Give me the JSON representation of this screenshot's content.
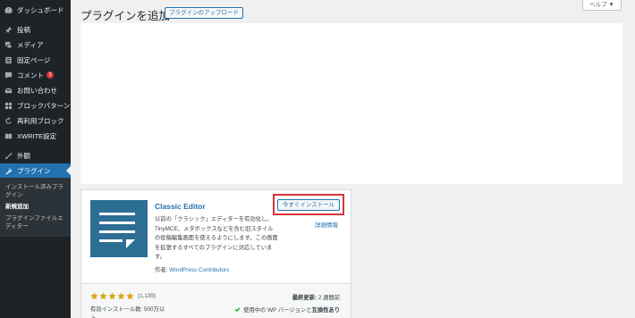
{
  "sidebar": {
    "items": [
      {
        "label": "ダッシュボード",
        "icon": "dashboard-icon"
      },
      {
        "label": "投稿",
        "icon": "pin-icon"
      },
      {
        "label": "メディア",
        "icon": "media-icon"
      },
      {
        "label": "固定ページ",
        "icon": "page-icon"
      },
      {
        "label": "コメント",
        "icon": "comment-icon",
        "badge": "3"
      },
      {
        "label": "お問い合わせ",
        "icon": "mail-icon"
      },
      {
        "label": "ブロックパターン",
        "icon": "grid-icon"
      },
      {
        "label": "再利用ブロック",
        "icon": "reuse-icon"
      },
      {
        "label": "XWRITE設定",
        "icon": "book-icon"
      },
      {
        "label": "外観",
        "icon": "brush-icon"
      },
      {
        "label": "プラグイン",
        "icon": "plugin-icon",
        "active": true
      }
    ],
    "submenu": [
      {
        "label": "インストール済みプラグイン"
      },
      {
        "label": "新規追加",
        "current": true
      },
      {
        "label": "プラグインファイルエディター"
      }
    ]
  },
  "header": {
    "title": "プラグインを追加",
    "upload_label": "プラグインのアップロード",
    "help_label": "ヘルプ ▼"
  },
  "plugin_card": {
    "name": "Classic Editor",
    "install_label": "今すぐインストール",
    "details_label": "詳細情報",
    "description_lines": [
      "以前の「クラシック」エディターを有効化し、",
      "TinyMCE、メタボックスなどを含む旧スタイル",
      "の投稿編集画面を使えるようにします。この画面",
      "を拡張するすべてのプラグインに対応していま",
      "す。"
    ],
    "author_prefix": "作者:",
    "author_name": "WordPress Contributors",
    "rating": 5,
    "rating_count": "(1,139)",
    "installs_lines": [
      "有効インストール数: 500万以",
      "上"
    ],
    "last_updated_label": "最終更新:",
    "last_updated_value": "2 週間前",
    "compat_text_prefix": "使用中の WP バージョンと",
    "compat_text_strong": "互換性あり"
  },
  "colors": {
    "sidebar_bg": "#1d2327",
    "accent": "#2271b1",
    "highlight_border": "#d63638",
    "star": "#dba617",
    "compat_check": "#00a32a",
    "plugin_icon_bg": "#2d6e94"
  }
}
